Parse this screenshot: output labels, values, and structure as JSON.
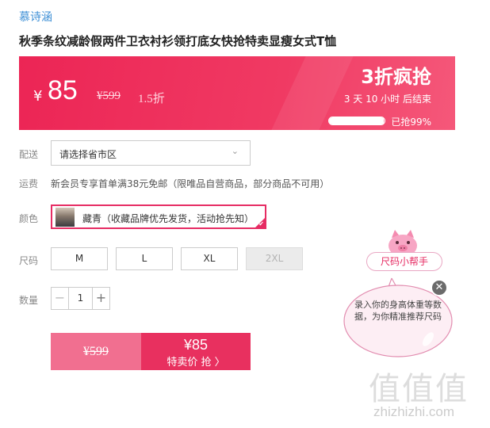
{
  "brand": "慕诗涵",
  "product_title": "秋季条纹减龄假两件卫衣衬衫领打底女快抢特卖显瘦女式T恤",
  "price": {
    "currency": "¥",
    "current": "85",
    "original": "¥599",
    "discount": "1.5折"
  },
  "promo": {
    "title": "3折疯抢",
    "countdown": "3  天  10  小时  后结束",
    "sold_label": "已抢99%",
    "sold_fraction": 0.99
  },
  "shipping": {
    "label": "配送",
    "select_placeholder": "请选择省市区",
    "fee_label": "运费",
    "fee_text": "新会员专享首单满38元免邮（限唯品自营商品，部分商品不可用）"
  },
  "color": {
    "label": "颜色",
    "selected_option": "藏青（收藏品牌优先发货，活动抢先知）"
  },
  "size": {
    "label": "尺码",
    "options": [
      {
        "label": "M",
        "disabled": false
      },
      {
        "label": "L",
        "disabled": false
      },
      {
        "label": "XL",
        "disabled": false
      },
      {
        "label": "2XL",
        "disabled": true
      }
    ]
  },
  "quantity": {
    "label": "数量",
    "value": "1",
    "minus": "−",
    "plus": "+"
  },
  "buy": {
    "original": "¥599",
    "price": "¥85",
    "cta": "特卖价 抢 〉"
  },
  "size_helper": {
    "button_label": "尺码小帮手",
    "bubble_text": "录入你的身高体重等数据，为你精准推荐尺码",
    "close": "✕"
  },
  "watermark": {
    "glyphs": "值值值",
    "text": "zhizhizhi.com"
  },
  "colors": {
    "accent": "#e8305f",
    "banner": "#ec2555",
    "brand_link": "#3d8fd6"
  }
}
